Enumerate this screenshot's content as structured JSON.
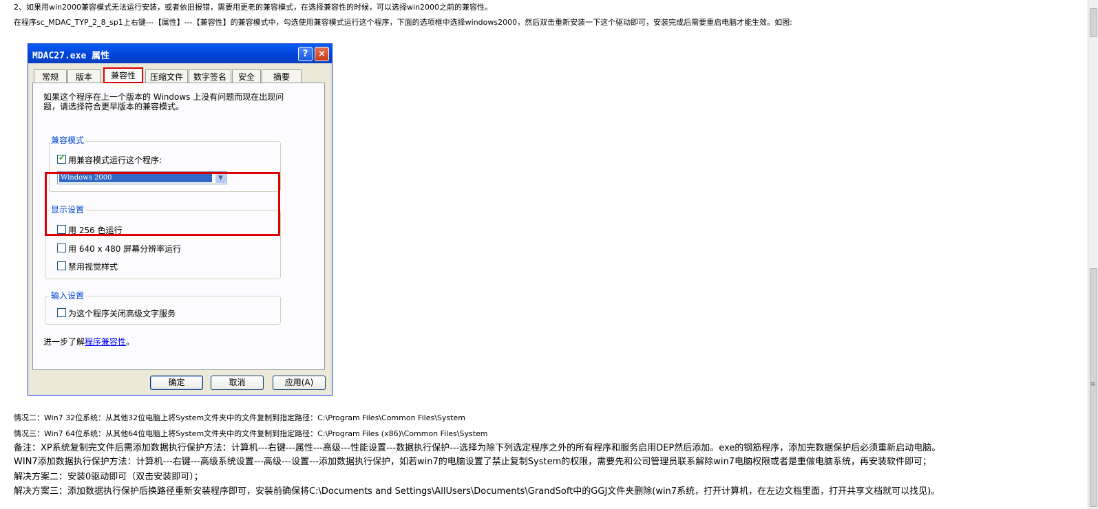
{
  "text": {
    "line1": "2、如果用win2000兼容模式无法运行安装，或者依旧报错，需要用更老的兼容模式，在选择兼容性的时候，可以选择win2000之前的兼容性。",
    "line2": "在程序sc_MDAC_TYP_2_8_sp1上右键---【属性】---【兼容性】的兼容模式中，勾选使用兼容模式运行这个程序，下面的选项框中选择windows2000，然后双击重新安装一下这个驱动即可，安装完成后需要重启电脑才能生效。如图:",
    "line3": "情况二：Win7 32位系统：从其他32位电脑上将System文件夹中的文件复制到指定路径：C:\\Program Files\\Common Files\\System",
    "line4": "情况三：Win7 64位系统：从其他64位电脑上将System文件夹中的文件复制到指定路径：C:\\Program Files (x86)\\Common Files\\System",
    "line5": "备注：XP系统复制完文件后需添加数据执行保护方法：计算机---右键---属性---高级---性能设置---数据执行保护---选择为除下列选定程序之外的所有程序和服务启用DEP然后添加。exe的钢筋程序，添加完数据保护后必须重新启动电脑。",
    "line6": "WIN7添加数据执行保护方法：计算机---右键---高级系统设置---高级---设置---添加数据执行保护，如若win7的电脑设置了禁止复制System的权限，需要先和公司管理员联系解除win7电脑权限或者是重做电脑系统，再安装软件即可；",
    "line7": "解决方案二：安装0驱动即可（双击安装即可）；",
    "line8": "解决方案三：添加数据执行保护后换路径重新安装程序即可，安装前确保将C:\\Documents and Settings\\AllUsers\\Documents\\GrandSoft中的GGJ文件夹删除(win7系统，打开计算机，在左边文档里面，打开共享文档就可以找见)。"
  },
  "dialog": {
    "title": "MDAC27.exe 属性",
    "help_button": "?",
    "close_button": "×",
    "tabs": [
      "常规",
      "版本",
      "兼容性",
      "压缩文件",
      "数字签名",
      "安全",
      "摘要"
    ],
    "active_tab": "兼容性",
    "description": "如果这个程序在上一个版本的 Windows 上没有问题而现在出现问题，请选择符合更早版本的兼容模式。",
    "compat_group": {
      "label": "兼容模式",
      "checkbox_label": "用兼容模式运行这个程序:",
      "checked": true,
      "selected_mode": "Windows 2000"
    },
    "display_group": {
      "label": "显示设置",
      "options": [
        {
          "label": "用 256 色运行",
          "checked": false
        },
        {
          "label": "用 640 x 480 屏幕分辨率运行",
          "checked": false
        },
        {
          "label": "禁用视觉样式",
          "checked": false
        }
      ]
    },
    "input_group": {
      "label": "输入设置",
      "option": {
        "label": "为这个程序关闭高级文字服务",
        "checked": false
      }
    },
    "more_prefix": "进一步了解",
    "more_link": "程序兼容性",
    "more_suffix": "。",
    "buttons": {
      "ok": "确定",
      "cancel": "取消",
      "apply": "应用(A)"
    }
  },
  "colors": {
    "highlight_border": "#dd0000",
    "titlebar": "#0a5ef0",
    "link": "#0000ff",
    "group_label": "#0046d5"
  }
}
